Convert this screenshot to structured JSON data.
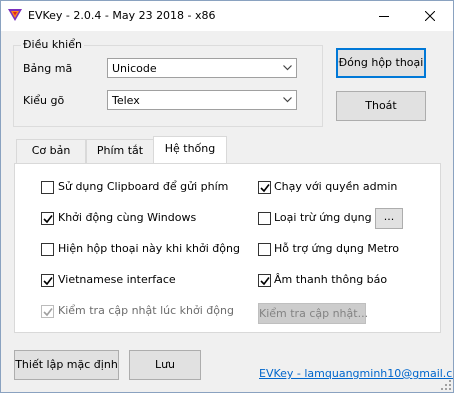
{
  "window": {
    "title": "EVKey - 2.0.4 - May 23 2018 - x86"
  },
  "settings_group": {
    "legend": "Điều khiển",
    "charset_label": "Bảng mã",
    "charset_value": "Unicode",
    "input_method_label": "Kiểu gõ",
    "input_method_value": "Telex"
  },
  "side_buttons": {
    "close_dialog": "Đóng hộp thoại",
    "exit": "Thoát"
  },
  "tabs": [
    {
      "label": "Cơ bản",
      "active": false
    },
    {
      "label": "Phím tắt",
      "active": false
    },
    {
      "label": "Hệ thống",
      "active": true
    }
  ],
  "options": {
    "use_clipboard": {
      "label": "Sử dụng Clipboard để gửi phím",
      "checked": false
    },
    "start_with_windows": {
      "label": "Khởi động cùng Windows",
      "checked": true
    },
    "show_dialog_on_start": {
      "label": "Hiện hộp thoại này khi khởi động",
      "checked": false
    },
    "vietnamese_interface": {
      "label": "Vietnamese interface",
      "checked": true
    },
    "check_updates_on_start": {
      "label": "Kiểm tra cập nhật lúc khởi động",
      "checked": true,
      "disabled": true
    },
    "run_as_admin": {
      "label": "Chạy với quyền admin",
      "checked": true
    },
    "exclude_apps": {
      "label": "Loại trừ ứng dụng",
      "checked": false
    },
    "metro_support": {
      "label": "Hỗ trợ ứng dụng Metro",
      "checked": false
    },
    "notification_sound": {
      "label": "Âm thanh thông báo",
      "checked": true
    }
  },
  "exclude_apps_button": "...",
  "check_update_button": "Kiểm tra cập nhật...",
  "footer": {
    "reset_defaults": "Thiết lập mặc định",
    "save": "Lưu",
    "link": "EVKey - lamquangminh10@gmail.com"
  },
  "colors": {
    "accent": "#0078d7",
    "link": "#0066cc",
    "window_bg": "#f0f0f0"
  }
}
